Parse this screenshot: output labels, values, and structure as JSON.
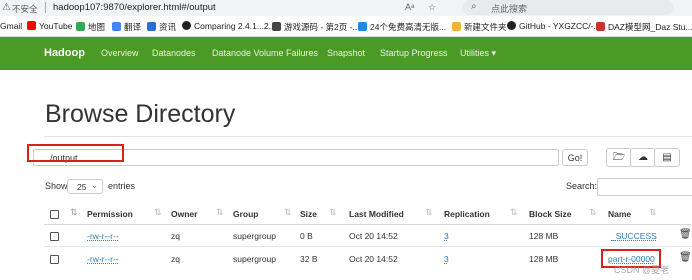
{
  "browser": {
    "insecure_label": "不安全",
    "url": "hadoop107:9870/explorer.html#/output",
    "search_placeholder": "点此搜索"
  },
  "bookmarks": [
    {
      "label": "Gmail",
      "color": "#ea4335"
    },
    {
      "label": "YouTube",
      "color": "#ff0000"
    },
    {
      "label": "地图",
      "color": "#34a853"
    },
    {
      "label": "翻译",
      "color": "#4285f4"
    },
    {
      "label": "资讯",
      "color": "#2a6edb"
    },
    {
      "label": "Comparing 2.4.1...2....",
      "color": "#222222"
    },
    {
      "label": "游戏源码 - 第2页 -...",
      "color": "#444444"
    },
    {
      "label": "24个免费高清无版...",
      "color": "#1e88e5"
    },
    {
      "label": "新建文件夹",
      "color": "#f2b233"
    },
    {
      "label": "GitHub - YXGZCC/-...",
      "color": "#222222"
    },
    {
      "label": "DAZ模型网_Daz Stu...",
      "color": "#c9352b"
    }
  ],
  "navbar": {
    "brand": "Hadoop",
    "items": [
      "Overview",
      "Datanodes",
      "Datanode Volume Failures",
      "Snapshot",
      "Startup Progress",
      "Utilities ▾"
    ],
    "color": "#4b9a26"
  },
  "page": {
    "title": "Browse Directory",
    "path": "/output",
    "go_label": "Go!",
    "show_label": "Show",
    "entries_value": "25",
    "entries_label": "entries",
    "search_label": "Search:"
  },
  "table": {
    "headers": [
      "Permission",
      "Owner",
      "Group",
      "Size",
      "Last Modified",
      "Replication",
      "Block Size",
      "Name"
    ],
    "rows": [
      {
        "permission": "-rw-r--r--",
        "owner": "zq",
        "group": "supergroup",
        "size": "0 B",
        "modified": "Oct 20 14:52",
        "replication": "3",
        "block_size": "128 MB",
        "name": "_SUCCESS"
      },
      {
        "permission": "-rw-r--r--",
        "owner": "zq",
        "group": "supergroup",
        "size": "32 B",
        "modified": "Oct 20 14:52",
        "replication": "3",
        "block_size": "128 MB",
        "name": "part-r-00000"
      }
    ]
  },
  "watermark": "CSDN @夏老"
}
